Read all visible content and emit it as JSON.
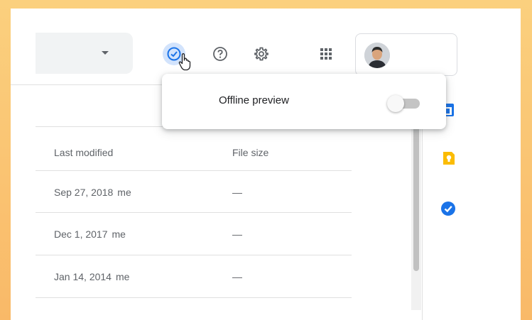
{
  "header": {
    "icons": {
      "search_dropdown": "chevron-down-icon",
      "offline": "offline-check-icon",
      "help": "help-icon",
      "settings": "gear-icon",
      "apps": "apps-grid-icon"
    },
    "accent_color": "#1a73e8"
  },
  "popup": {
    "label": "Offline preview",
    "toggle_on": false
  },
  "table": {
    "columns": [
      "Last modified",
      "File size"
    ],
    "rows": [
      {
        "modified": "Sep 27, 2018",
        "owner": "me",
        "size": "—"
      },
      {
        "modified": "Dec 1, 2017",
        "owner": "me",
        "size": "—"
      },
      {
        "modified": "Jan 14, 2014",
        "owner": "me",
        "size": "—"
      }
    ]
  },
  "side_panel": {
    "apps": [
      "calendar-icon",
      "keep-icon",
      "tasks-icon"
    ],
    "colors": {
      "calendar": "#1a73e8",
      "keep": "#fbbc04",
      "tasks": "#1a73e8"
    }
  }
}
